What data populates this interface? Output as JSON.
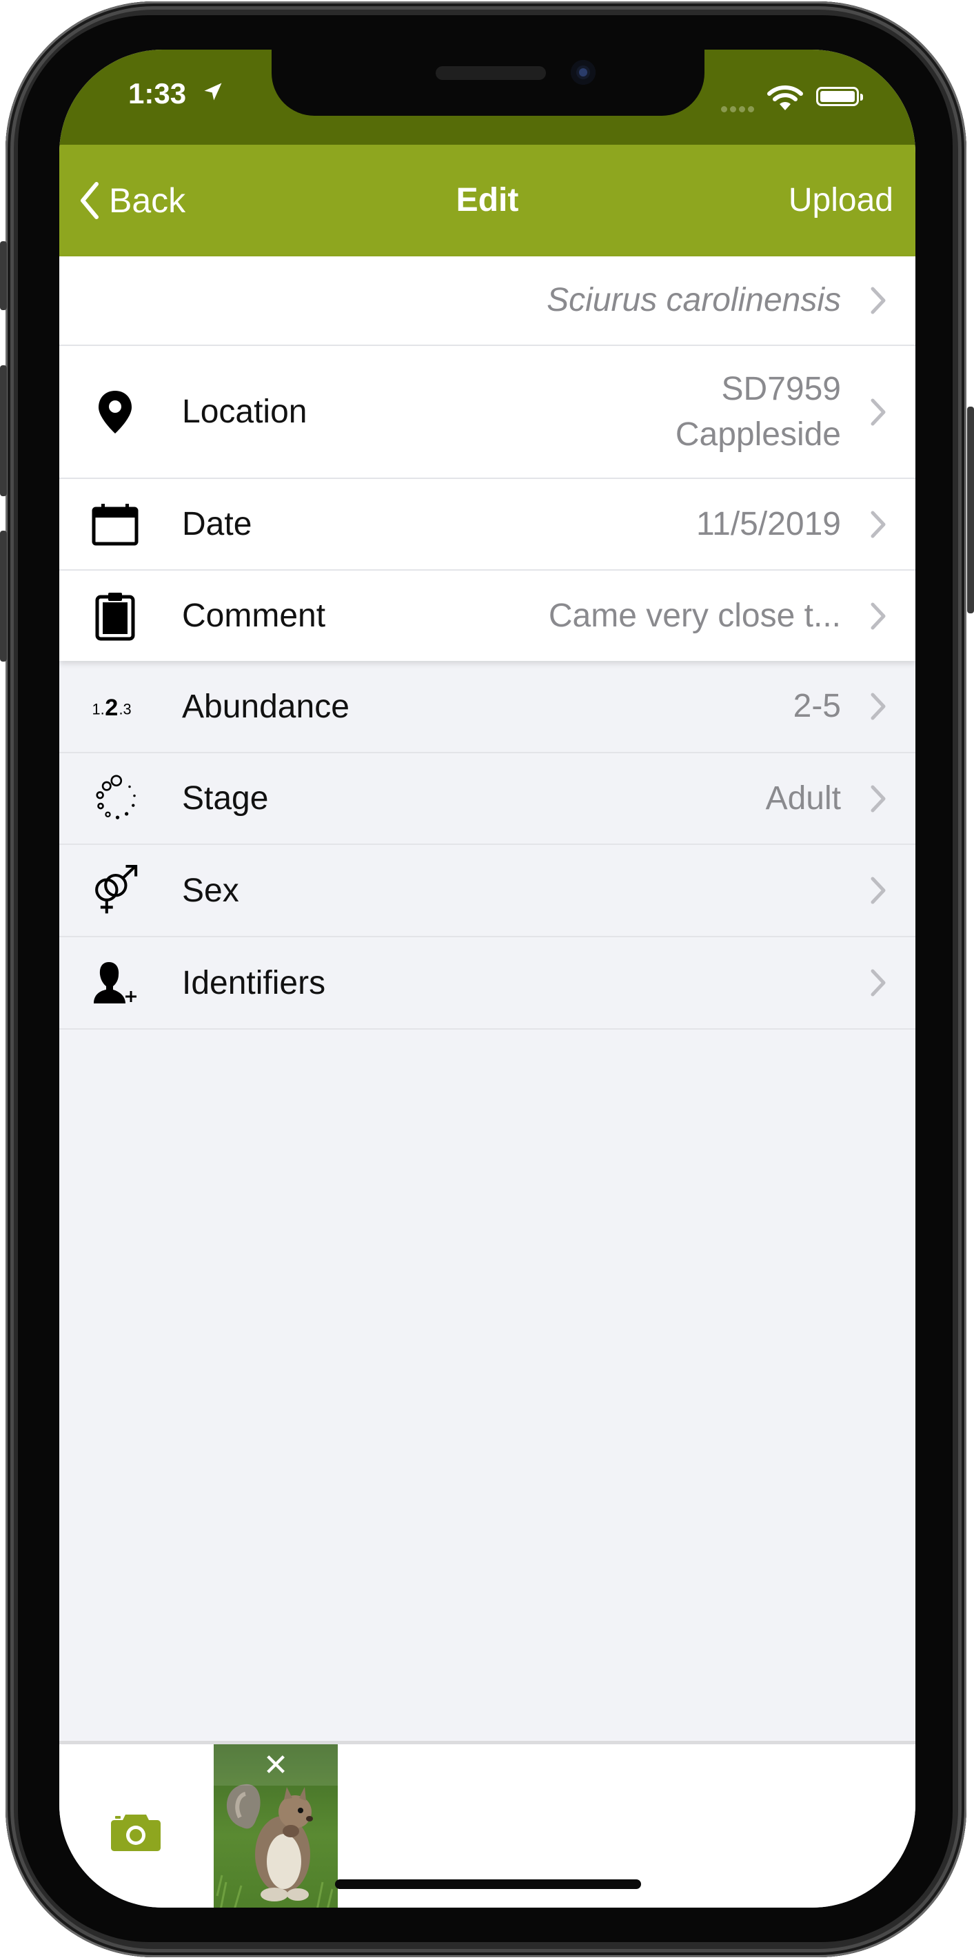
{
  "status_bar": {
    "time": "1:33"
  },
  "nav": {
    "back_label": "Back",
    "title": "Edit",
    "upload_label": "Upload"
  },
  "species": {
    "value": "Sciurus carolinensis"
  },
  "rows_top": {
    "location": {
      "label": "Location",
      "value_line1": "SD7959",
      "value_line2": "Cappleside"
    },
    "date": {
      "label": "Date",
      "value": "11/5/2019"
    },
    "comment": {
      "label": "Comment",
      "value": "Came very close t..."
    }
  },
  "rows_bottom": {
    "abundance": {
      "label": "Abundance",
      "value": "2-5"
    },
    "stage": {
      "label": "Stage",
      "value": "Adult"
    },
    "sex": {
      "label": "Sex",
      "value": ""
    },
    "identifiers": {
      "label": "Identifiers",
      "value": ""
    }
  },
  "photo_bar": {
    "close_symbol": "✕"
  },
  "colors": {
    "status_bar": "#566c08",
    "nav_bar": "#8ea61f",
    "accent": "#8ea61f",
    "background": "#f2f3f7"
  },
  "icons": {
    "location": "map-pin-icon",
    "date": "calendar-icon",
    "comment": "clipboard-icon",
    "abundance": "number-sequence-icon",
    "stage": "life-stage-icon",
    "sex": "gender-icon",
    "identifiers": "person-add-icon",
    "camera": "camera-icon"
  }
}
